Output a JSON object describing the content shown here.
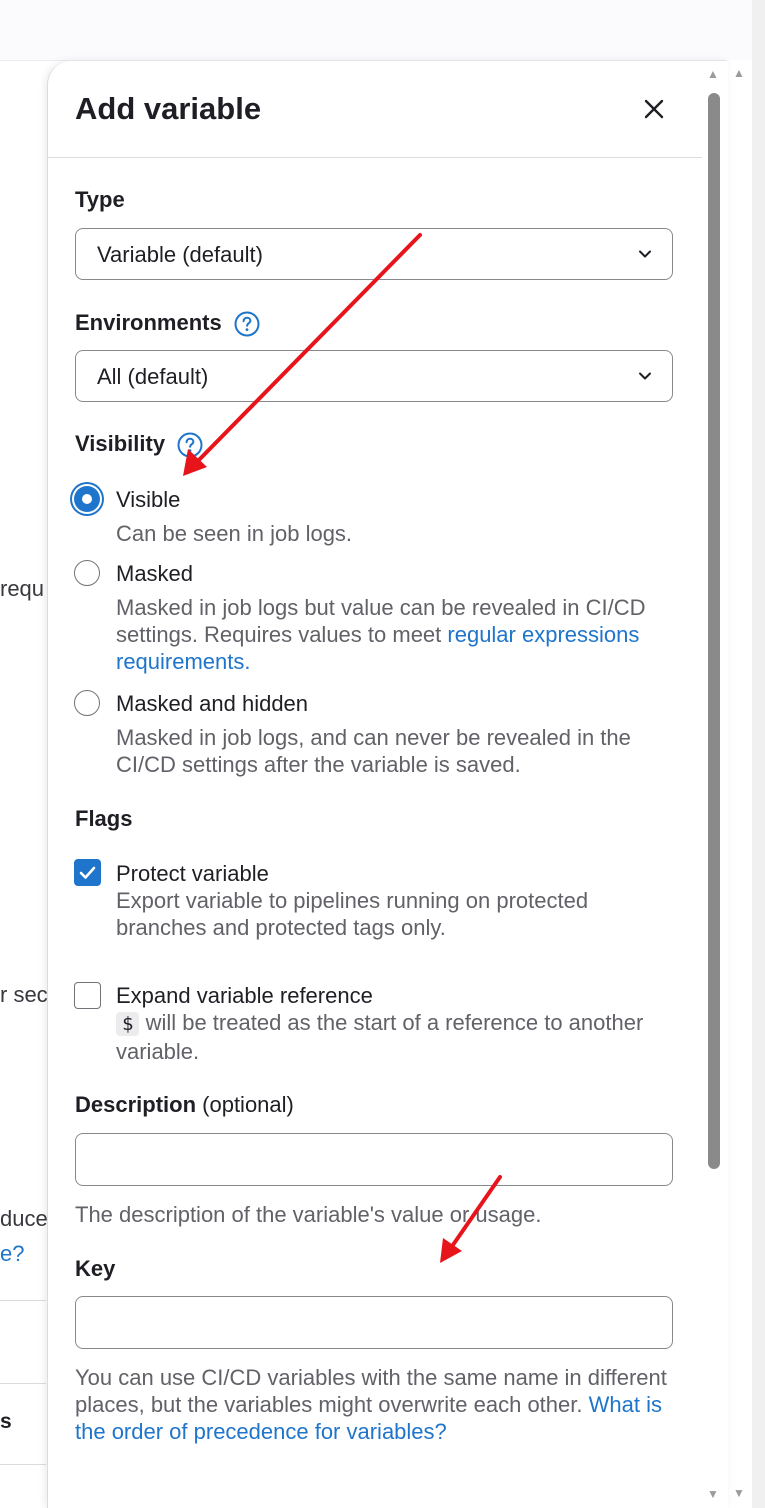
{
  "background": {
    "fragments": [
      "requ",
      "r sec",
      "duce",
      "e?",
      "s"
    ]
  },
  "drawer": {
    "title": "Add variable",
    "close_icon": "close-icon"
  },
  "type_field": {
    "label": "Type",
    "value": "Variable (default)"
  },
  "environments_field": {
    "label": "Environments",
    "value": "All (default)"
  },
  "visibility": {
    "label": "Visibility",
    "options": [
      {
        "title": "Visible",
        "help": "Can be seen in job logs.",
        "checked": true
      },
      {
        "title": "Masked",
        "help": "Masked in job logs but value can be revealed in CI/CD settings. Requires values to meet ",
        "link": "regular expressions requirements.",
        "checked": false
      },
      {
        "title": "Masked and hidden",
        "help": "Masked in job logs, and can never be revealed in the CI/CD settings after the variable is saved.",
        "checked": false
      }
    ]
  },
  "flags": {
    "label": "Flags",
    "protect": {
      "title": "Protect variable",
      "help": "Export variable to pipelines running on protected branches and protected tags only.",
      "checked": true
    },
    "expand": {
      "title": "Expand variable reference",
      "code": "$",
      "help": " will be treated as the start of a reference to another variable.",
      "checked": false
    }
  },
  "description_field": {
    "label": "Description",
    "optional": " (optional)",
    "value": "",
    "help": "The description of the variable's value or usage."
  },
  "key_field": {
    "label": "Key",
    "value": "",
    "help": "You can use CI/CD variables with the same name in different places, but the variables might overwrite each other. ",
    "link": "What is the order of precedence for variables?"
  },
  "colors": {
    "accent": "#1f75cb",
    "annotation_arrow": "#e8141b"
  }
}
